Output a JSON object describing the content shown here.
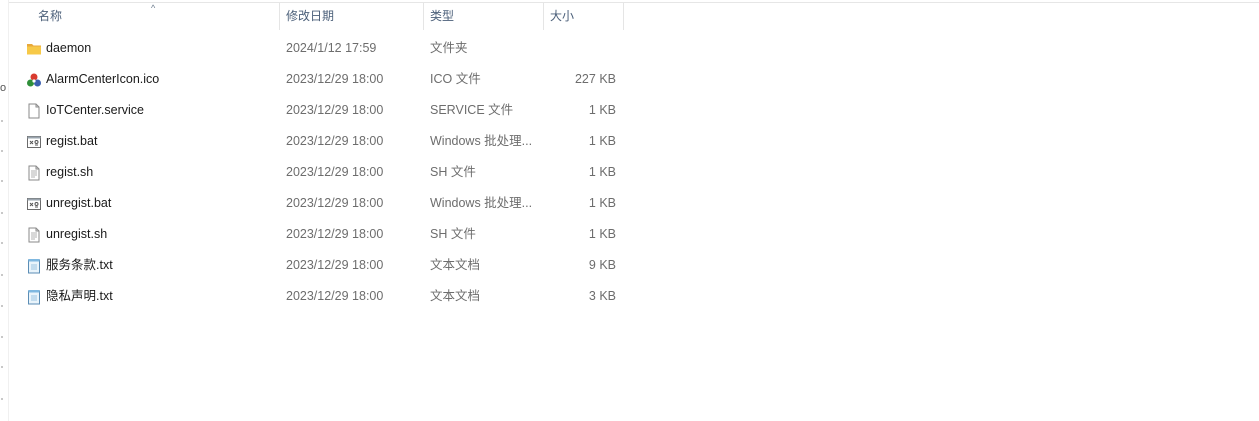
{
  "columns": {
    "name": "名称",
    "date": "修改日期",
    "type": "类型",
    "size": "大小"
  },
  "sort_indicator": "^",
  "left_strip_glyph": "o",
  "files": [
    {
      "name": "daemon",
      "date": "2024/1/12 17:59",
      "type": "文件夹",
      "size": "",
      "icon": "folder-icon"
    },
    {
      "name": "AlarmCenterIcon.ico",
      "date": "2023/12/29 18:00",
      "type": "ICO 文件",
      "size": "227 KB",
      "icon": "alarm-center-app-icon"
    },
    {
      "name": "IoTCenter.service",
      "date": "2023/12/29 18:00",
      "type": "SERVICE 文件",
      "size": "1 KB",
      "icon": "blank-file-icon"
    },
    {
      "name": "regist.bat",
      "date": "2023/12/29 18:00",
      "type": "Windows 批处理...",
      "size": "1 KB",
      "icon": "batch-file-icon"
    },
    {
      "name": "regist.sh",
      "date": "2023/12/29 18:00",
      "type": "SH 文件",
      "size": "1 KB",
      "icon": "text-file-icon"
    },
    {
      "name": "unregist.bat",
      "date": "2023/12/29 18:00",
      "type": "Windows 批处理...",
      "size": "1 KB",
      "icon": "batch-file-icon"
    },
    {
      "name": "unregist.sh",
      "date": "2023/12/29 18:00",
      "type": "SH 文件",
      "size": "1 KB",
      "icon": "text-file-icon"
    },
    {
      "name": "服务条款.txt",
      "date": "2023/12/29 18:00",
      "type": "文本文档",
      "size": "9 KB",
      "icon": "notepad-file-icon"
    },
    {
      "name": "隐私声明.txt",
      "date": "2023/12/29 18:00",
      "type": "文本文档",
      "size": "3 KB",
      "icon": "notepad-file-icon"
    }
  ],
  "colors": {
    "header_text": "#4c607a",
    "folder": "#f5c242",
    "secondary_text": "#6d6d6d"
  }
}
